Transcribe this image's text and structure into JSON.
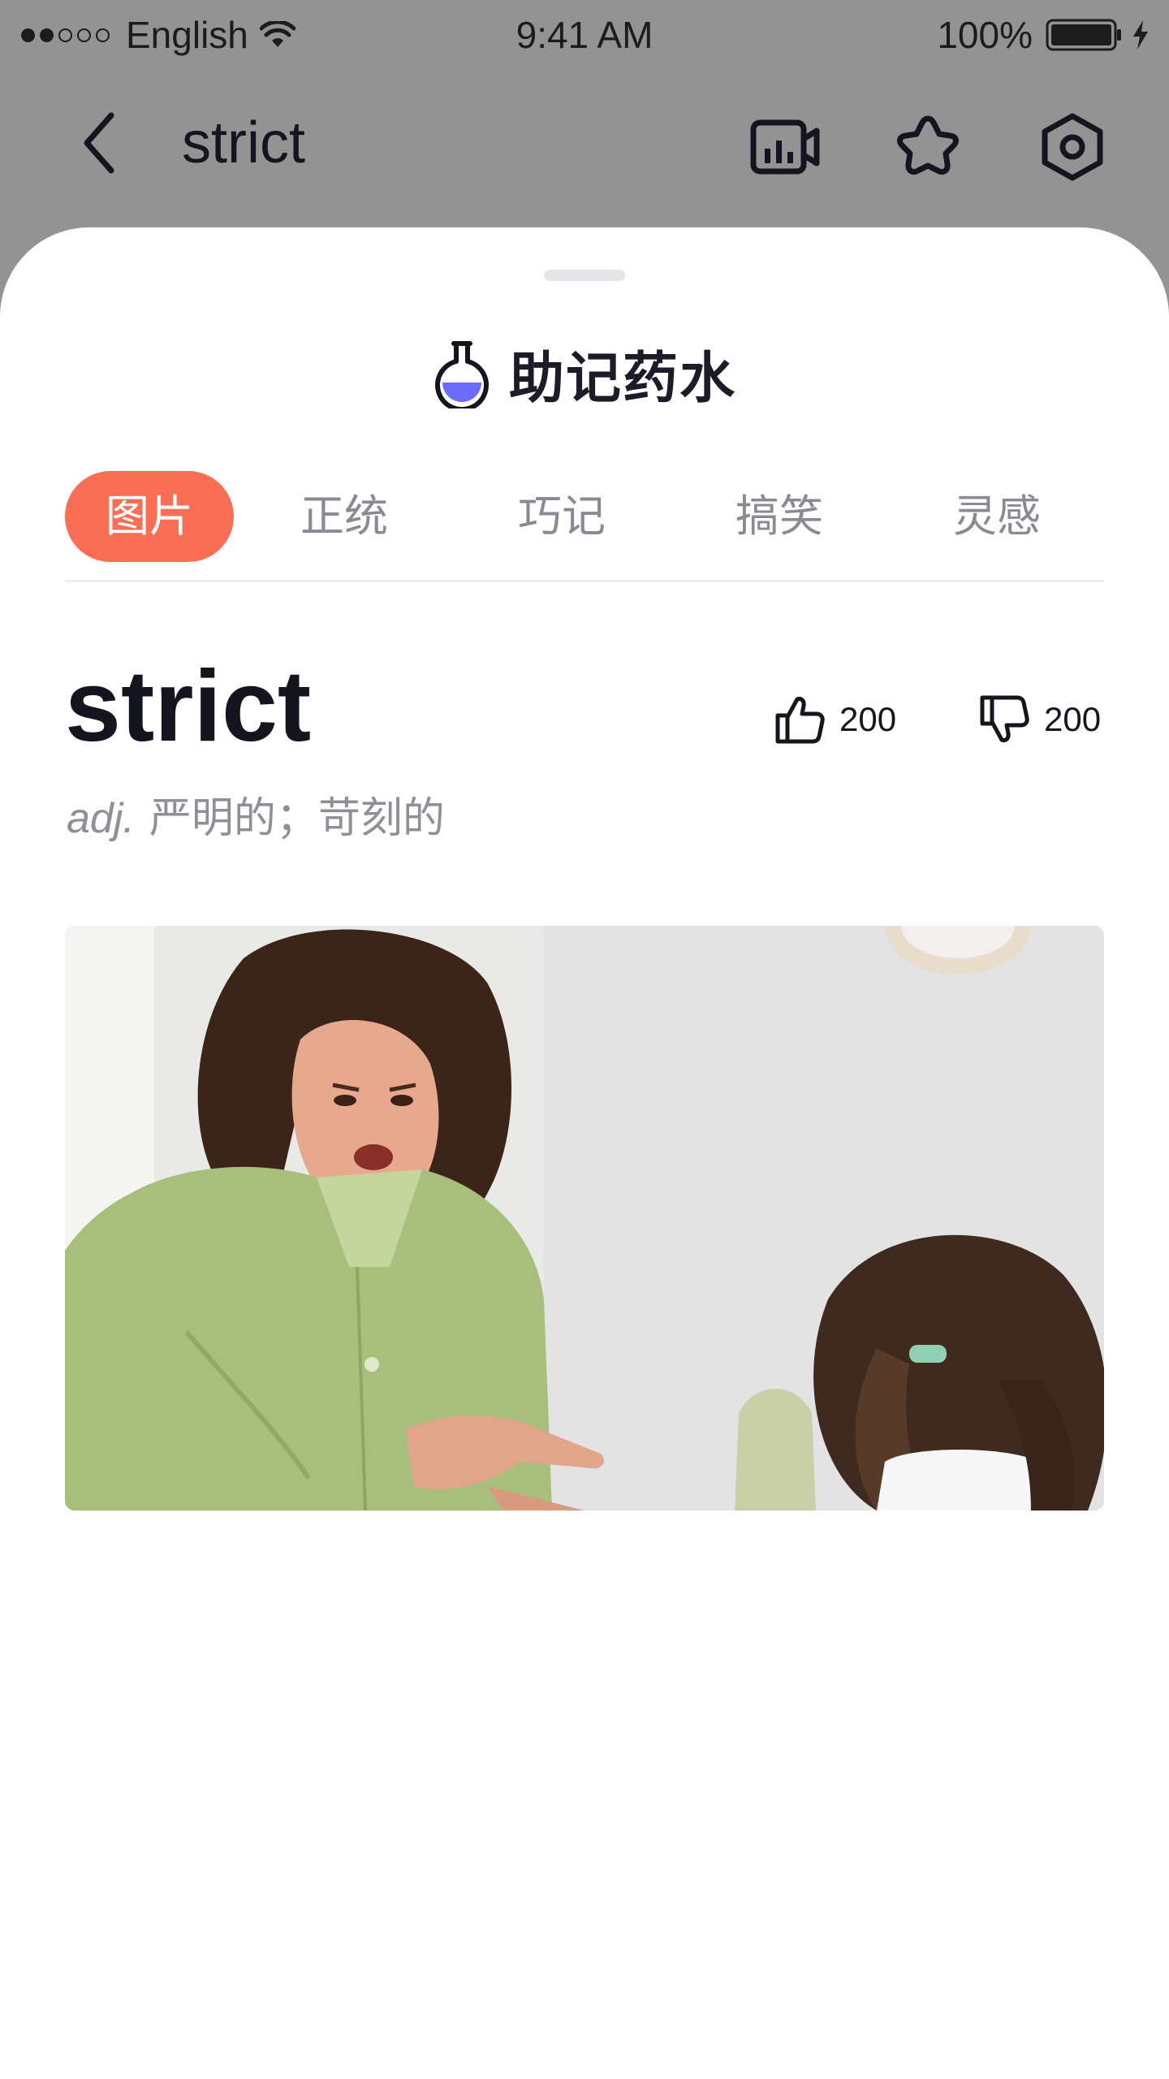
{
  "status_bar": {
    "carrier": "English",
    "time": "9:41 AM",
    "battery": "100%"
  },
  "nav": {
    "title": "strict",
    "icons": [
      "back-chevron-icon",
      "video-icon",
      "star-icon",
      "settings-icon"
    ]
  },
  "sheet": {
    "title": "助记药水",
    "icon": "potion-flask-icon",
    "tabs": [
      {
        "label": "图片",
        "active": true
      },
      {
        "label": "正统",
        "active": false
      },
      {
        "label": "巧记",
        "active": false
      },
      {
        "label": "搞笑",
        "active": false
      },
      {
        "label": "灵感",
        "active": false
      }
    ]
  },
  "entry": {
    "word": "strict",
    "pos": "adj.",
    "meaning": "严明的；苛刻的",
    "likes": "200",
    "dislikes": "200"
  },
  "colors": {
    "accent": "#fa6e55",
    "flask_liquid": "#6b6bff",
    "backdrop": "#939394"
  }
}
